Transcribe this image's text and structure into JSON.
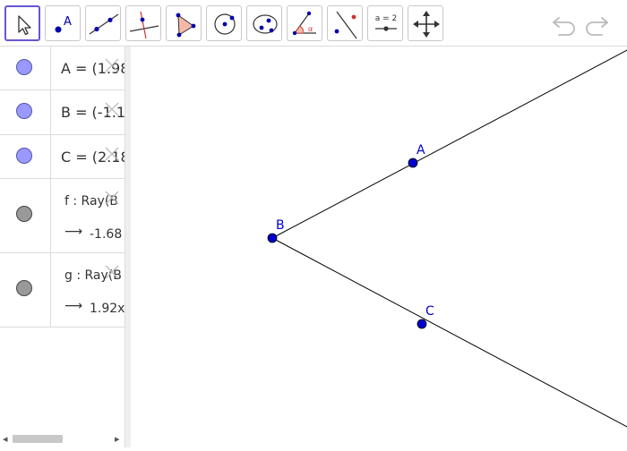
{
  "toolbar": {
    "tools": [
      {
        "icon": "move-arrow-icon",
        "selected": true
      },
      {
        "icon": "point-icon",
        "label": "A"
      },
      {
        "icon": "line-icon"
      },
      {
        "icon": "perpendicular-line-icon"
      },
      {
        "icon": "polygon-icon"
      },
      {
        "icon": "circle-center-point-icon"
      },
      {
        "icon": "conic-icon"
      },
      {
        "icon": "angle-icon"
      },
      {
        "icon": "reflect-icon"
      },
      {
        "icon": "slider-icon",
        "label": "a = 2"
      },
      {
        "icon": "move-graphics-view-icon"
      }
    ],
    "undo_icon": "undo-icon",
    "redo_icon": "redo-icon"
  },
  "algebra": {
    "items": [
      {
        "definition": "A = (1.98",
        "color": "#9999ff"
      },
      {
        "definition": "B = (-1.1",
        "color": "#9999ff"
      },
      {
        "definition": "C = (2.18",
        "color": "#9999ff"
      },
      {
        "definition": "f : Ray(B",
        "value": "-1.68",
        "color": "#999999"
      },
      {
        "definition": "g : Ray(B",
        "value": "1.92x",
        "color": "#999999"
      }
    ]
  },
  "graphics": {
    "points": [
      {
        "name": "A"
      },
      {
        "name": "B"
      },
      {
        "name": "C"
      }
    ],
    "point_color": "#0000cc",
    "line_color": "#000000"
  }
}
